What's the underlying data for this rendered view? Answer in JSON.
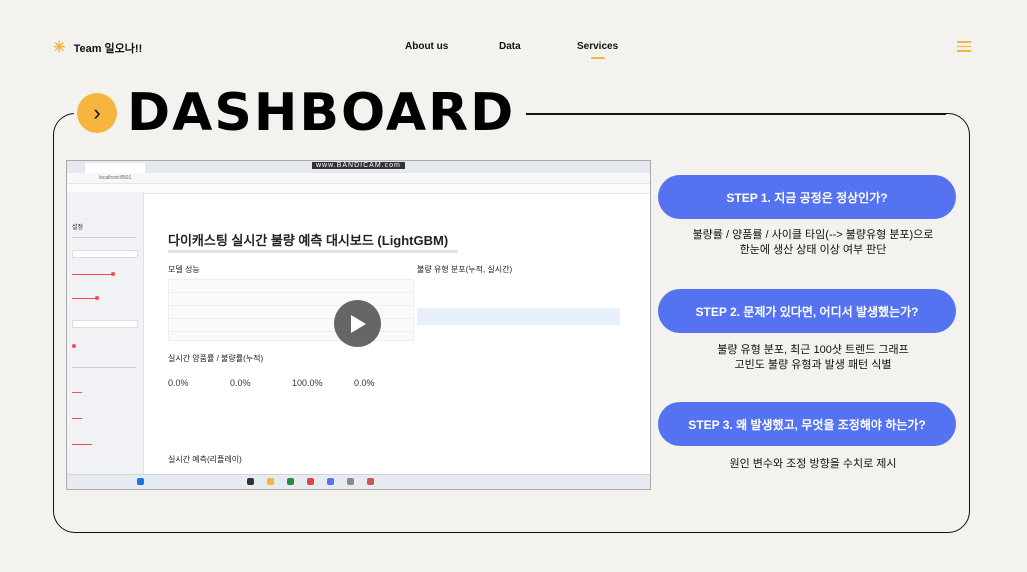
{
  "nav": {
    "brand": "Team 일오나!!",
    "links": [
      "About us",
      "Data",
      "Services"
    ],
    "active": "Services"
  },
  "hero": {
    "title": "DASHBOARD"
  },
  "screenshot": {
    "watermark": "www.BANDICAM.com",
    "url": "localhost:8501",
    "app_title": "다이캐스팅 실시간 불량 예측 대시보드 (LightGBM)",
    "section_model": "모델 성능",
    "section_dist": "불량 유형 분포(누적, 실시간)",
    "section_rates": "실시간 양품률 / 불량률(누적)",
    "section_live": "실시간 예측(리플레이)",
    "sidebar_title": "설정",
    "metrics": [
      "0.0%",
      "0.0%",
      "100.0%",
      "0.0%"
    ]
  },
  "steps": [
    {
      "label": "STEP 1. 지금 공정은 정상인가?",
      "desc": [
        "불량률 / 양품률 / 사이클 타임(--> 불량유형 분포)으로",
        "한눈에 생산 상태 이상 여부 판단"
      ]
    },
    {
      "label": "STEP 2. 문제가 있다면, 어디서 발생했는가?",
      "desc": [
        "불량 유형 분포, 최근 100샷 트렌드 그래프",
        "고빈도 불량 유형과 발생 패턴 식별"
      ]
    },
    {
      "label": "STEP 3. 왜 발생했고, 무엇을 조정해야 하는가?",
      "desc": [
        "원인 변수와 조정 방향을 수치로 제시"
      ]
    }
  ]
}
